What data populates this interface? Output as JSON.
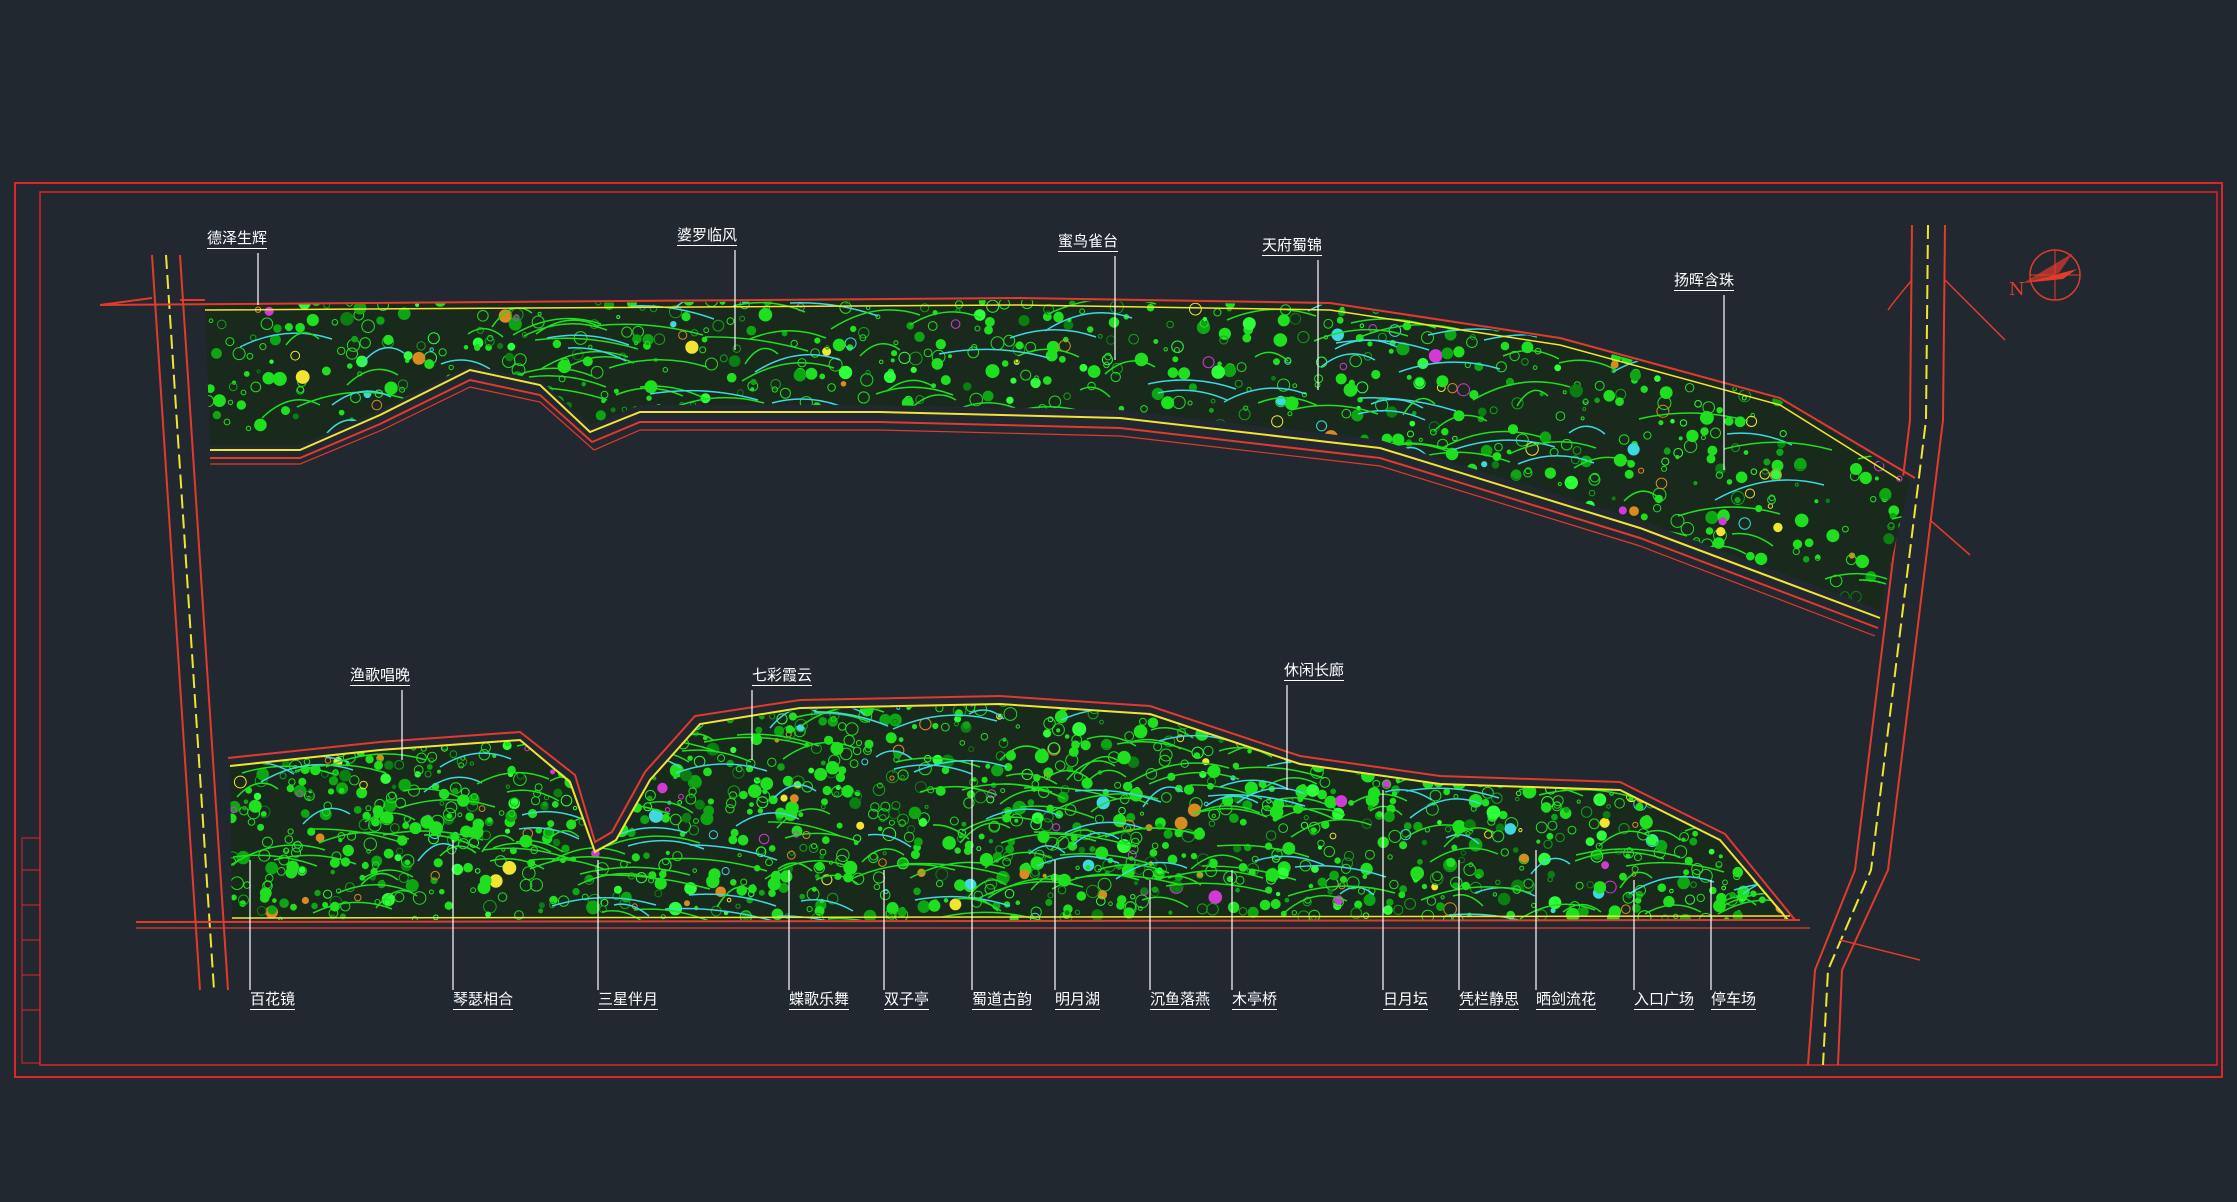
{
  "colors": {
    "background": "#212830",
    "frame": "#e0242a",
    "road_edge": "#e23b2c",
    "road_center": "#f2e531",
    "vegetation": "#1fe01f",
    "vegetation_dark": "#0ea514",
    "accent_orange": "#d98b22",
    "accent_magenta": "#d23ad6",
    "accent_cyan": "#3fd8e0",
    "label": "#ffffff"
  },
  "compass": {
    "label": "N"
  },
  "labels": {
    "north": [
      "德泽生辉",
      "婆罗临风",
      "蜜鸟雀台",
      "天府蜀锦",
      "扬晖含珠"
    ],
    "south_top": [
      "渔歌唱晚",
      "七彩霞云",
      "休闲长廊"
    ],
    "south_bottom": [
      "百花镜",
      "琴瑟相合",
      "三星伴月",
      "蝶歌乐舞",
      "双子亭",
      "蜀道古韵",
      "明月湖",
      "沉鱼落燕",
      "木亭桥",
      "日月坛",
      "凭栏静思",
      "晒剑流花",
      "入口广场",
      "停车场"
    ]
  }
}
